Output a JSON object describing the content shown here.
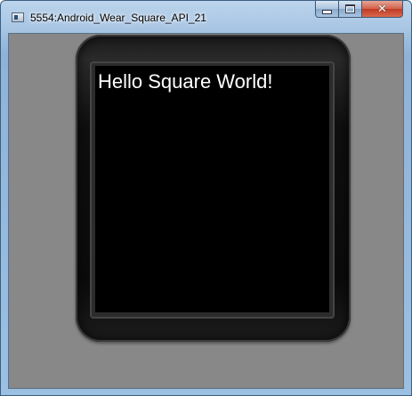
{
  "window": {
    "title": "5554:Android_Wear_Square_API_21",
    "icon": "emulator-app-icon",
    "controls": {
      "minimize": "minimize-icon",
      "maximize": "maximize-icon",
      "close": "✕"
    }
  },
  "device": {
    "screen_text": "Hello Square World!"
  },
  "colors": {
    "emulator_background": "#888888",
    "screen_background": "#000000",
    "text": "#ffffff"
  }
}
